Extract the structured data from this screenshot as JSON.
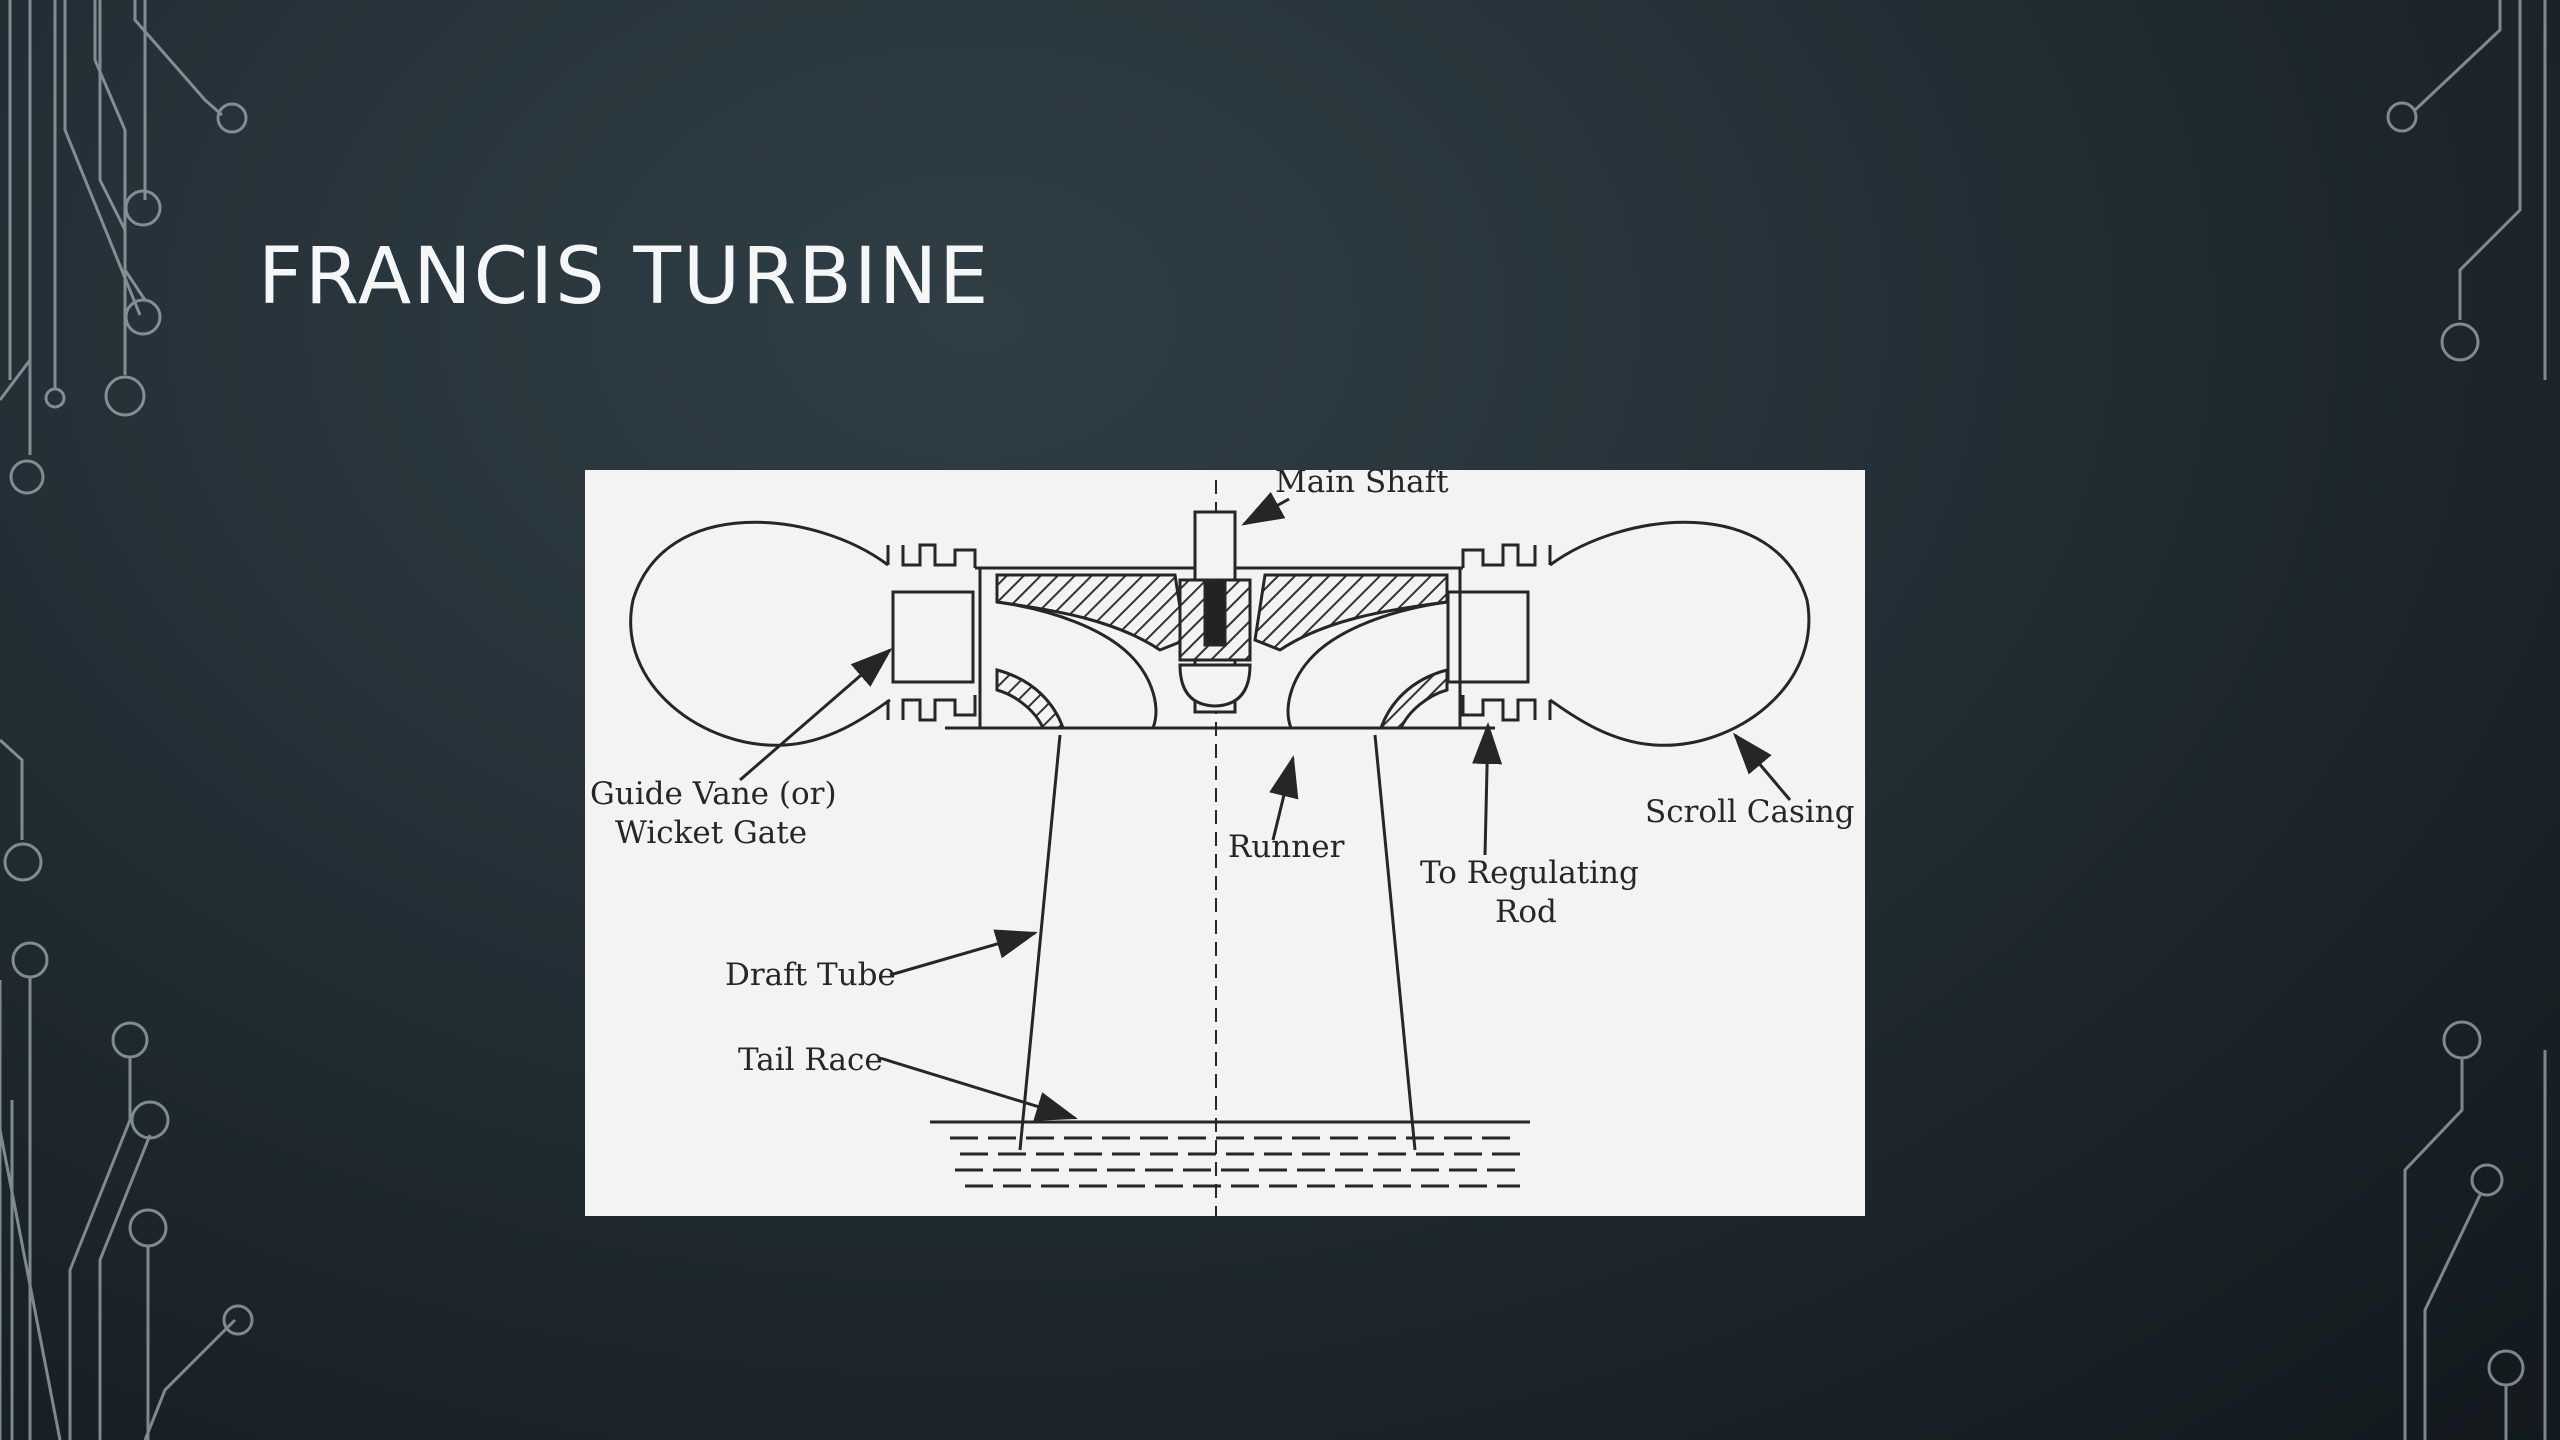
{
  "slide": {
    "title": "FRANCIS TURBINE"
  },
  "diagram": {
    "labels": {
      "main_shaft": "Main Shaft",
      "guide_vane_line1": "Guide Vane (or)",
      "guide_vane_line2": "Wicket Gate",
      "runner": "Runner",
      "regulating_line1": "To Regulating",
      "regulating_line2": "Rod",
      "scroll_casing": "Scroll Casing",
      "draft_tube": "Draft Tube",
      "tail_race": "Tail Race"
    }
  },
  "colors": {
    "background": "#1f2a30",
    "circuit": "#a6b3bb",
    "title": "#f5f7f7",
    "figure_bg": "#f3f3f1",
    "ink": "#262626"
  }
}
